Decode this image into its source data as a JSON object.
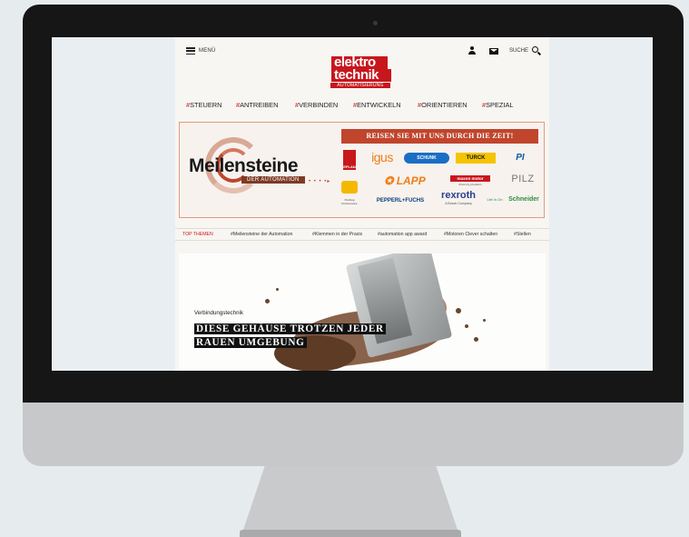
{
  "header": {
    "menu_label": "MENÜ",
    "search_label": "SUCHE",
    "logo_line1": "elektro",
    "logo_line2": "technik",
    "logo_sub": "AUTOMATISIERUNG"
  },
  "nav": {
    "items": [
      {
        "hash": "#",
        "label": "STEUERN"
      },
      {
        "hash": "#",
        "label": "ANTREIBEN"
      },
      {
        "hash": "#",
        "label": "VERBINDEN"
      },
      {
        "hash": "#",
        "label": "ENTWICKELN"
      },
      {
        "hash": "#",
        "label": "ORIENTIEREN"
      },
      {
        "hash": "#",
        "label": "SPEZIAL"
      }
    ]
  },
  "banner": {
    "title": "Meilensteine",
    "subtitle": "DER AUTOMATION",
    "headline": "REISEN SIE MIT UNS DURCH DIE ZEIT!",
    "brands": {
      "eplan": "EPLAN",
      "igus": "igus",
      "schunk": "SCHUNK",
      "turck": "TURCK",
      "pi": "PI",
      "lapp": "LAPP",
      "maxon": "maxon motor",
      "maxon_sub": "driven by precision",
      "pilz": "PILZ",
      "harting_sub": "Pushing Performance",
      "pf": "PEPPERL+FUCHS",
      "rexroth": "rexroth",
      "rexroth_sub": "A Bosch Company",
      "lifeison": "Life Is On",
      "schneider": "Schneider"
    }
  },
  "topthemen": {
    "label": "TOP THEMEN",
    "items": [
      "#Meilensteine der Automation",
      "#Klemmen in der Praxis",
      "#automation app award",
      "#Motoren Clever schalten",
      "#Stellen"
    ]
  },
  "hero": {
    "category": "Verbindungstechnik",
    "title_line1": "DIESE GEHÄUSE TROTZEN JEDER",
    "title_line2": "RAUEN UMGEBUNG"
  },
  "colors": {
    "brand_red": "#c8161d",
    "banner_accent": "#c0452c",
    "bezel": "#161616"
  }
}
